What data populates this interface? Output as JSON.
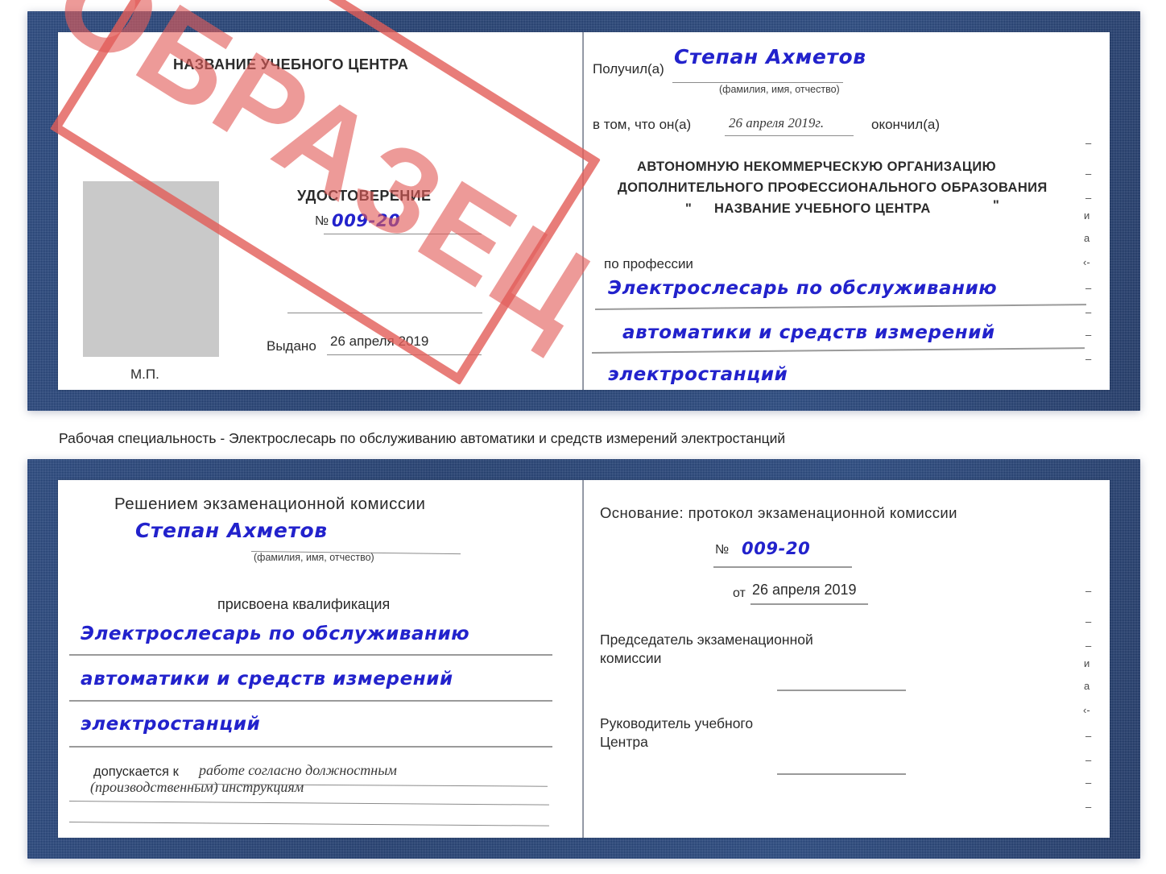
{
  "watermark": {
    "label": "ОБРАЗЕЦ"
  },
  "caption": {
    "text": "Рабочая специальность - Электрослесарь по обслуживанию автоматики и средств измерений электростанций"
  },
  "certificate_1": {
    "left_page": {
      "center_name": "НАЗВАНИЕ УЧЕБНОГО ЦЕНТРА",
      "title": "УДОСТОВЕРЕНИЕ",
      "number_label": "№",
      "number_value": "009-20",
      "issued_label": "Выдано",
      "issued_value": "26 апреля 2019",
      "stamp_label": "М.П."
    },
    "right_page": {
      "received_label": "Получил(а)",
      "received_value": "Степан Ахметов",
      "fio_hint": "(фамилия, имя, отчество)",
      "that_he_label": "в том, что он(а)",
      "date_value": "26 апреля 2019г.",
      "finished_label": "окончил(а)",
      "org_line1": "АВТОНОМНУЮ НЕКОММЕРЧЕСКУЮ ОРГАНИЗАЦИЮ",
      "org_line2": "ДОПОЛНИТЕЛЬНОГО ПРОФЕССИОНАЛЬНОГО ОБРАЗОВАНИЯ",
      "org_quote_open": "\"",
      "org_line3": "НАЗВАНИЕ УЧЕБНОГО ЦЕНТРА",
      "org_quote_close": "\"",
      "profession_label": "по профессии",
      "profession_line1": "Электрослесарь по обслуживанию",
      "profession_line2": "автоматики и средств измерений",
      "profession_line3": "электростанций",
      "margin_fragments": [
        "–",
        "–",
        "–",
        "и",
        "а",
        "‹-",
        "–",
        "–",
        "–",
        "–"
      ]
    }
  },
  "certificate_2": {
    "left_page": {
      "heading": "Решением экзаменационной комиссии",
      "name_value": "Степан Ахметов",
      "fio_hint": "(фамилия, имя, отчество)",
      "qualification_label": "присвоена квалификация",
      "qualification_line1": "Электрослесарь по обслуживанию",
      "qualification_line2": "автоматики и средств измерений",
      "qualification_line3": "электростанций",
      "allowed_label": "допускается к",
      "allowed_value_line1": "работе согласно должностным",
      "allowed_value_line2": "(производственным) инструкциям"
    },
    "right_page": {
      "basis_label": "Основание: протокол экзаменационной комиссии",
      "number_label": "№",
      "number_value": "009-20",
      "date_label": "от",
      "date_value": "26 апреля 2019",
      "chairman_line1": "Председатель экзаменационной",
      "chairman_line2": "комиссии",
      "head_line1": "Руководитель учебного",
      "head_line2": "Центра",
      "margin_fragments": [
        "–",
        "–",
        "–",
        "и",
        "а",
        "‹-",
        "–",
        "–",
        "–",
        "–"
      ]
    }
  },
  "colors": {
    "cover_blue": "#1d3a6e",
    "handwriting_blue": "#2222cc",
    "watermark_red": "#e25c58",
    "photo_gray": "#c9c9c9"
  }
}
